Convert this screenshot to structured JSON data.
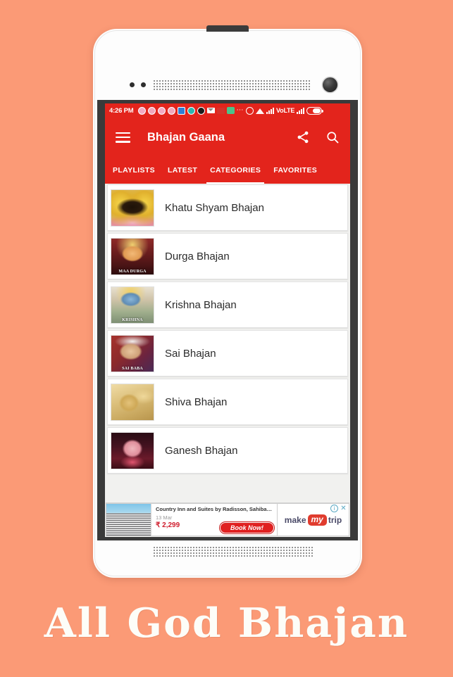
{
  "background_color": "#fb9a76",
  "accent_color": "#e3241c",
  "caption": "All God Bhajan",
  "phone": {
    "status_bar": {
      "time": "4:26 PM",
      "network": "VoLTE",
      "icons": [
        "instagram-icon",
        "instagram-icon-2",
        "instagram-icon-3",
        "instagram-icon-4",
        "contact-icon",
        "browser-icon",
        "camera-icon",
        "mail-icon",
        "app-icon-red",
        "gallery-icon",
        "more-icon",
        "alarm-icon",
        "wifi-icon",
        "signal-icon",
        "volte-label",
        "signal-icon-2",
        "battery-icon"
      ]
    },
    "app_bar": {
      "menu_label": "menu",
      "title": "Bhajan Gaana",
      "share_label": "share",
      "search_label": "search"
    },
    "tabs": [
      {
        "label": "PLAYLISTS",
        "active": false
      },
      {
        "label": "LATEST",
        "active": false
      },
      {
        "label": "CATEGORIES",
        "active": true
      },
      {
        "label": "FAVORITES",
        "active": false
      }
    ],
    "categories": [
      {
        "title": "Khatu Shyam Bhajan",
        "art": "art-khatu",
        "thumb_caption": ""
      },
      {
        "title": "Durga Bhajan",
        "art": "art-durga",
        "thumb_caption": "MAA DURGA"
      },
      {
        "title": "Krishna Bhajan",
        "art": "art-krishna",
        "thumb_caption": "KRISHNA"
      },
      {
        "title": "Sai Bhajan",
        "art": "art-sai",
        "thumb_caption": "SAI BABA"
      },
      {
        "title": "Shiva Bhajan",
        "art": "art-shiva",
        "thumb_caption": ""
      },
      {
        "title": "Ganesh Bhajan",
        "art": "art-ganesh",
        "thumb_caption": ""
      }
    ],
    "ad": {
      "headline": "Country Inn and Suites by Radisson, Sahibabad New...",
      "date": "13 Mar",
      "price": "₹ 2,299",
      "cta": "Book Now!",
      "brand_prefix": "make",
      "brand_badge": "my",
      "brand_suffix": "trip",
      "info_label": "i",
      "close_label": "✕"
    }
  }
}
